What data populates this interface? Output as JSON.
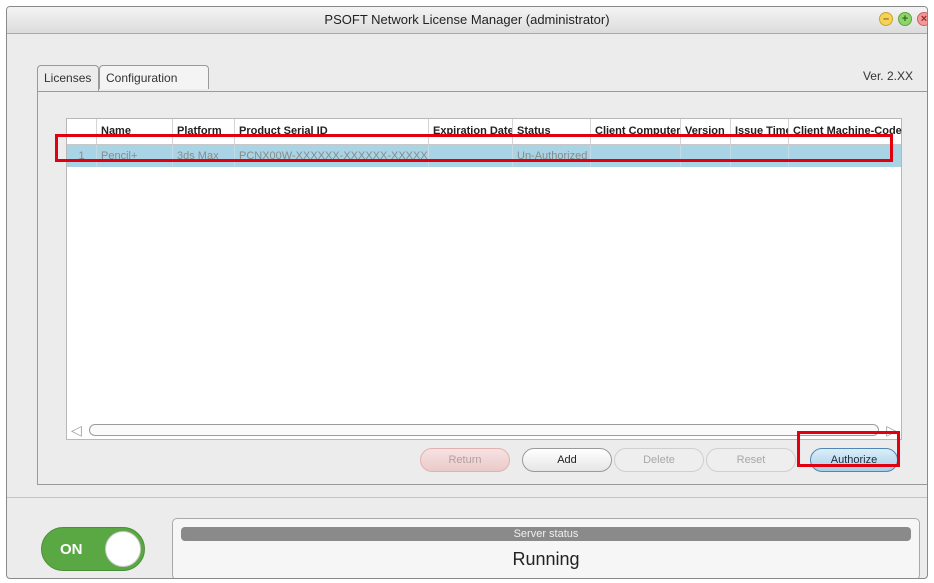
{
  "window": {
    "title": "PSOFT Network License Manager (administrator)"
  },
  "tabs": [
    {
      "label": "Licenses",
      "active": true
    },
    {
      "label": "Configuration",
      "active": false
    }
  ],
  "version": "Ver. 2.XX",
  "table": {
    "columns": [
      "Name",
      "Platform",
      "Product Serial ID",
      "Expiration Date",
      "Status",
      "Client Computer",
      "Version",
      "Issue Time",
      "Client Machine-Code"
    ],
    "rows": [
      {
        "num": "1",
        "name": "Pencil+",
        "platform": "3ds Max",
        "serial": "PCNX00W-XXXXXX-XXXXXX-XXXXXX",
        "expiration": "",
        "status": "Un-Authorized",
        "client_computer": "",
        "version": "",
        "issue_time": "",
        "machine_code": ""
      }
    ]
  },
  "buttons": {
    "return": "Return",
    "add": "Add",
    "delete": "Delete",
    "reset": "Reset",
    "authorize": "Authorize"
  },
  "toggle": {
    "label": "ON",
    "state": "on"
  },
  "server_status": {
    "header": "Server status",
    "value": "Running"
  },
  "colors": {
    "highlight": "#e00010",
    "selected_row": "#a8d4e6",
    "toggle_on": "#5aa844"
  }
}
